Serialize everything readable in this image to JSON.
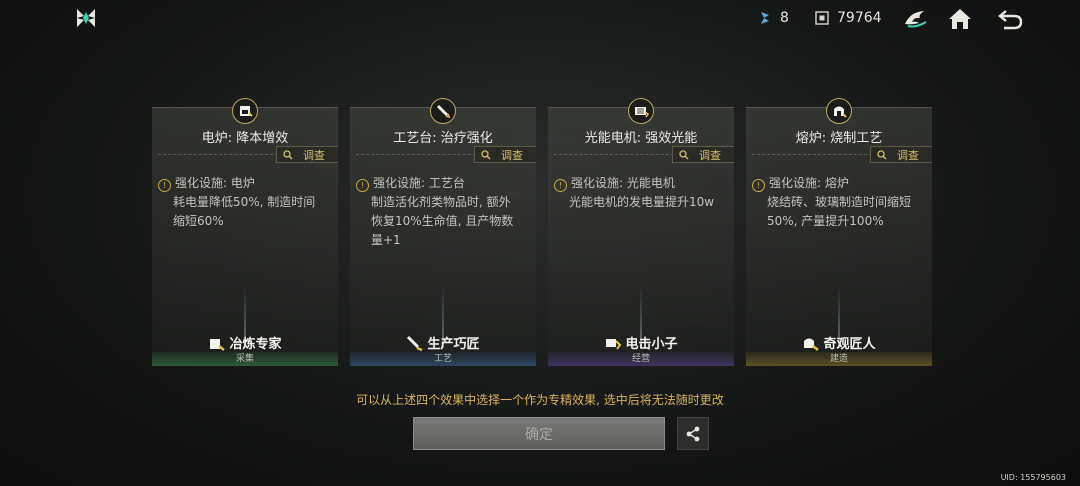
{
  "header": {
    "resource_a_value": "8",
    "resource_b_value": "79764",
    "icons": [
      "game-logo-icon",
      "energy-icon",
      "chip-icon",
      "dragon-icon",
      "home-icon",
      "back-icon"
    ]
  },
  "cards": [
    {
      "title": "电炉: 降本增效",
      "inspect": "调查",
      "desc_lines": [
        "强化设施: 电炉",
        "耗电量降低50%, 制造时间",
        "缩短60%"
      ],
      "specialty": "冶炼专家",
      "category": "采集",
      "accent": "#3a6b44"
    },
    {
      "title": "工艺台: 治疗强化",
      "inspect": "调查",
      "desc_lines": [
        "强化设施: 工艺台",
        "制造活化剂类物品时, 额外",
        "恢复10%生命值, 且产物数",
        "量+1"
      ],
      "specialty": "生产巧匠",
      "category": "工艺",
      "accent": "#34506e"
    },
    {
      "title": "光能电机: 强效光能",
      "inspect": "调查",
      "desc_lines": [
        "强化设施: 光能电机",
        "光能电机的发电量提升10w"
      ],
      "specialty": "电击小子",
      "category": "经营",
      "accent": "#4c3f6e"
    },
    {
      "title": "熔炉: 烧制工艺",
      "inspect": "调查",
      "desc_lines": [
        "强化设施: 熔炉",
        "烧结砖、玻璃制造时间缩短",
        "50%, 产量提升100%"
      ],
      "specialty": "奇观匠人",
      "category": "建造",
      "accent": "#6b5a2c"
    }
  ],
  "footer": {
    "notice": "可以从上述四个效果中选择一个作为专精效果, 选中后将无法随时更改",
    "confirm_label": "确定",
    "uid": "UID: 155795603"
  }
}
